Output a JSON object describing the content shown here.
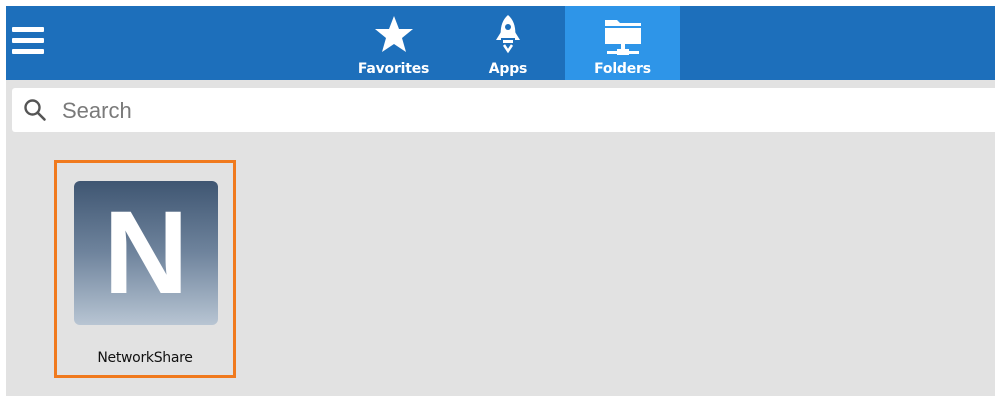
{
  "toolbar": {
    "menu_icon": "hamburger-menu-icon",
    "tabs": [
      {
        "label": "Favorites",
        "icon": "star-icon",
        "active": false
      },
      {
        "label": "Apps",
        "icon": "rocket-icon",
        "active": false
      },
      {
        "label": "Folders",
        "icon": "network-folder-icon",
        "active": true
      }
    ],
    "colors": {
      "bar": "#1d6fbb",
      "active_tab": "#2e95e8"
    }
  },
  "search": {
    "placeholder": "Search",
    "value": "",
    "icon": "search-icon"
  },
  "folders": {
    "items": [
      {
        "letter": "N",
        "label": "NetworkShare",
        "selected": true
      }
    ],
    "colors": {
      "selection_border": "#f07a1e",
      "content_bg": "#e2e2e2"
    }
  }
}
